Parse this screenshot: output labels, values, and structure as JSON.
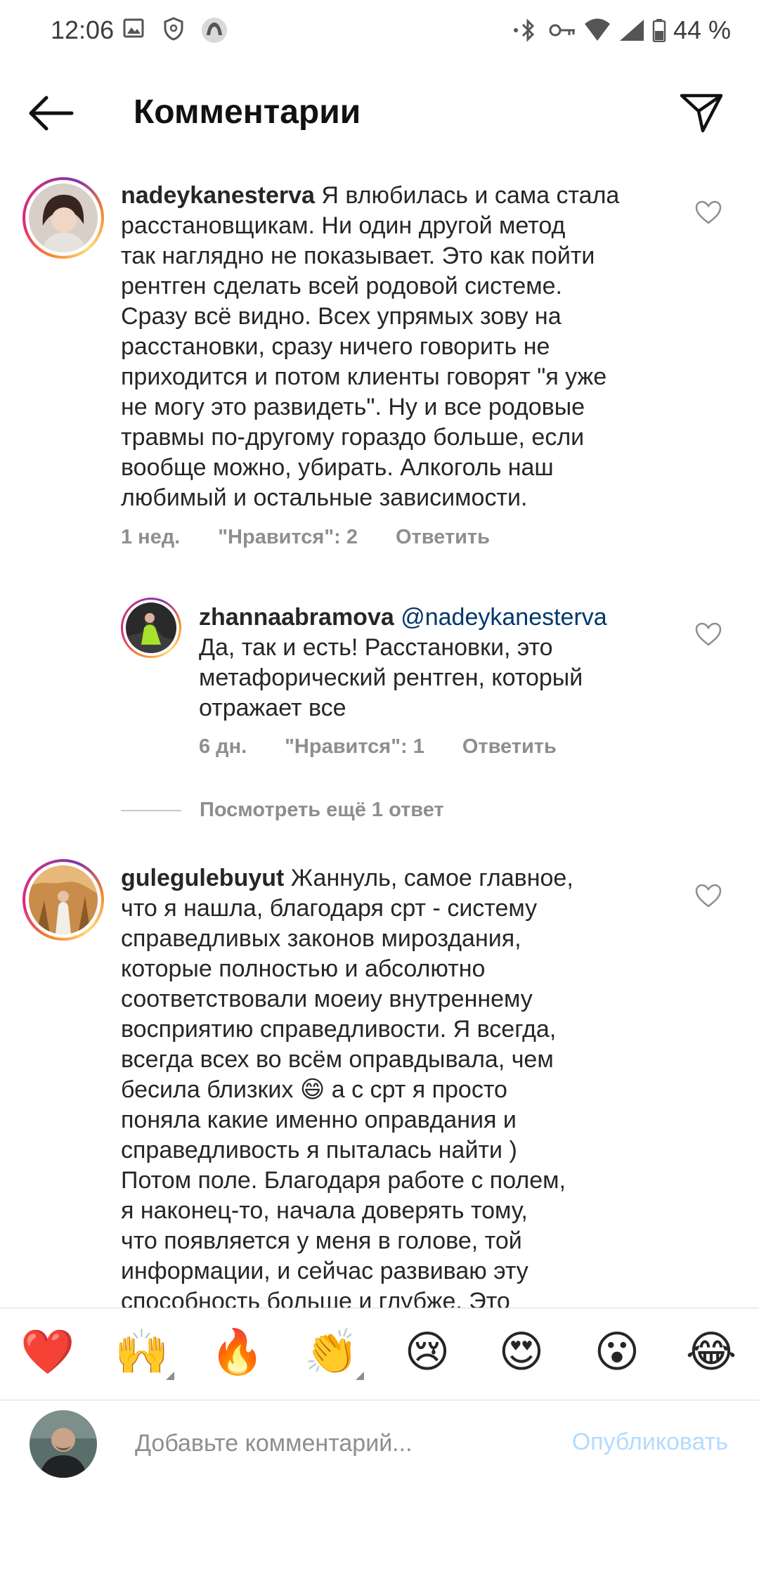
{
  "status_bar": {
    "time": "12:06",
    "battery": "44 %"
  },
  "header": {
    "title": "Комментарии"
  },
  "comments": [
    {
      "user": "nadeykanesterva",
      "lines": [
        "Я влюбилась и сама стала",
        "расстановщикам. Ни один другой метод",
        "так наглядно не показывает. Это как пойти",
        "рентген сделать всей родовой системе.",
        "Сразу всё видно. Всех упрямых зову на",
        "расстановки, сразу ничего говорить не",
        "приходится и потом клиенты говорят \"я уже",
        "не могу это развидеть\". Ну и все родовые",
        "травмы по-другому гораздо больше, если",
        "вообще можно, убирать. Алкоголь наш",
        "любимый и остальные зависимости."
      ],
      "time": "1 нед.",
      "likes": "\"Нравится\": 2",
      "reply": "Ответить"
    },
    {
      "user": "zhannaabramova",
      "mention": "@nadeykanesterva",
      "lines": [
        "Да, так и есть! Расстановки, это",
        "метафорический рентген, который",
        "отражает все"
      ],
      "time": "6 дн.",
      "likes": "\"Нравится\": 1",
      "reply": "Ответить"
    },
    {
      "user": "gulegulebuyut",
      "lines": [
        "Жаннуль, самое главное,",
        "что я нашла, благодаря срт - систему",
        "справедливых законов мироздания,",
        "которые полностью и абсолютно",
        "соответствовали моеиу внутреннему",
        "восприятию справедливости. Я всегда,",
        "всегда всех во всём оправдывала, чем",
        "бесила близких 😄 а с срт я просто",
        "поняла какие именно оправдания и",
        "справедливость я пыталась найти )",
        "Потом поле. Благодаря работе с полем,",
        "я наконец-то, начала доверять тому,",
        "что появляется у меня в голове, той",
        "информации, и сейчас развиваю эту",
        "способность больше и глубже. Это"
      ]
    }
  ],
  "view_more_replies": "Посмотреть ещё 1 ответ",
  "reactions": [
    "❤️",
    "🙌",
    "🔥",
    "👏",
    "😢",
    "😍",
    "😮",
    "😂"
  ],
  "composer": {
    "placeholder": "Добавьте комментарий...",
    "post_label": "Опубликовать"
  }
}
